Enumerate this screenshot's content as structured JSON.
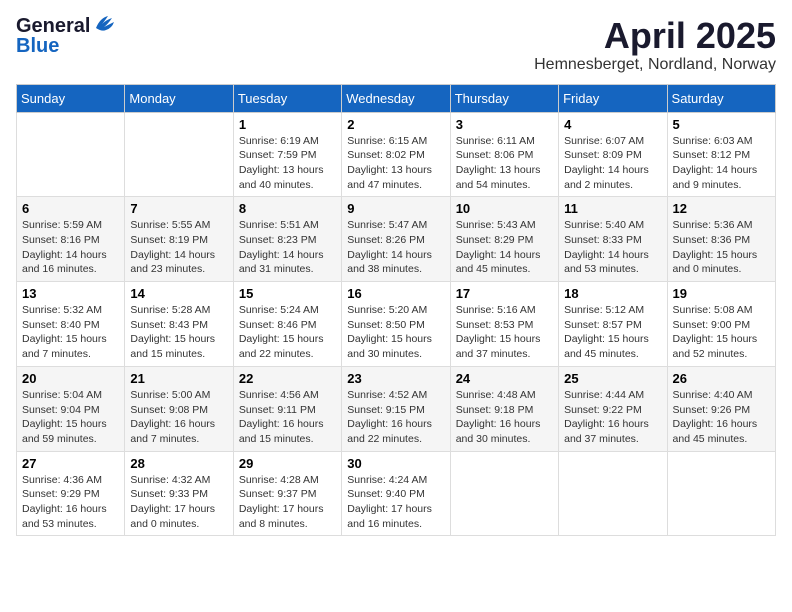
{
  "logo": {
    "general": "General",
    "blue": "Blue"
  },
  "header": {
    "month": "April 2025",
    "location": "Hemnesberget, Nordland, Norway"
  },
  "weekdays": [
    "Sunday",
    "Monday",
    "Tuesday",
    "Wednesday",
    "Thursday",
    "Friday",
    "Saturday"
  ],
  "weeks": [
    [
      {
        "day": "",
        "sunrise": "",
        "sunset": "",
        "daylight": ""
      },
      {
        "day": "",
        "sunrise": "",
        "sunset": "",
        "daylight": ""
      },
      {
        "day": "1",
        "sunrise": "Sunrise: 6:19 AM",
        "sunset": "Sunset: 7:59 PM",
        "daylight": "Daylight: 13 hours and 40 minutes."
      },
      {
        "day": "2",
        "sunrise": "Sunrise: 6:15 AM",
        "sunset": "Sunset: 8:02 PM",
        "daylight": "Daylight: 13 hours and 47 minutes."
      },
      {
        "day": "3",
        "sunrise": "Sunrise: 6:11 AM",
        "sunset": "Sunset: 8:06 PM",
        "daylight": "Daylight: 13 hours and 54 minutes."
      },
      {
        "day": "4",
        "sunrise": "Sunrise: 6:07 AM",
        "sunset": "Sunset: 8:09 PM",
        "daylight": "Daylight: 14 hours and 2 minutes."
      },
      {
        "day": "5",
        "sunrise": "Sunrise: 6:03 AM",
        "sunset": "Sunset: 8:12 PM",
        "daylight": "Daylight: 14 hours and 9 minutes."
      }
    ],
    [
      {
        "day": "6",
        "sunrise": "Sunrise: 5:59 AM",
        "sunset": "Sunset: 8:16 PM",
        "daylight": "Daylight: 14 hours and 16 minutes."
      },
      {
        "day": "7",
        "sunrise": "Sunrise: 5:55 AM",
        "sunset": "Sunset: 8:19 PM",
        "daylight": "Daylight: 14 hours and 23 minutes."
      },
      {
        "day": "8",
        "sunrise": "Sunrise: 5:51 AM",
        "sunset": "Sunset: 8:23 PM",
        "daylight": "Daylight: 14 hours and 31 minutes."
      },
      {
        "day": "9",
        "sunrise": "Sunrise: 5:47 AM",
        "sunset": "Sunset: 8:26 PM",
        "daylight": "Daylight: 14 hours and 38 minutes."
      },
      {
        "day": "10",
        "sunrise": "Sunrise: 5:43 AM",
        "sunset": "Sunset: 8:29 PM",
        "daylight": "Daylight: 14 hours and 45 minutes."
      },
      {
        "day": "11",
        "sunrise": "Sunrise: 5:40 AM",
        "sunset": "Sunset: 8:33 PM",
        "daylight": "Daylight: 14 hours and 53 minutes."
      },
      {
        "day": "12",
        "sunrise": "Sunrise: 5:36 AM",
        "sunset": "Sunset: 8:36 PM",
        "daylight": "Daylight: 15 hours and 0 minutes."
      }
    ],
    [
      {
        "day": "13",
        "sunrise": "Sunrise: 5:32 AM",
        "sunset": "Sunset: 8:40 PM",
        "daylight": "Daylight: 15 hours and 7 minutes."
      },
      {
        "day": "14",
        "sunrise": "Sunrise: 5:28 AM",
        "sunset": "Sunset: 8:43 PM",
        "daylight": "Daylight: 15 hours and 15 minutes."
      },
      {
        "day": "15",
        "sunrise": "Sunrise: 5:24 AM",
        "sunset": "Sunset: 8:46 PM",
        "daylight": "Daylight: 15 hours and 22 minutes."
      },
      {
        "day": "16",
        "sunrise": "Sunrise: 5:20 AM",
        "sunset": "Sunset: 8:50 PM",
        "daylight": "Daylight: 15 hours and 30 minutes."
      },
      {
        "day": "17",
        "sunrise": "Sunrise: 5:16 AM",
        "sunset": "Sunset: 8:53 PM",
        "daylight": "Daylight: 15 hours and 37 minutes."
      },
      {
        "day": "18",
        "sunrise": "Sunrise: 5:12 AM",
        "sunset": "Sunset: 8:57 PM",
        "daylight": "Daylight: 15 hours and 45 minutes."
      },
      {
        "day": "19",
        "sunrise": "Sunrise: 5:08 AM",
        "sunset": "Sunset: 9:00 PM",
        "daylight": "Daylight: 15 hours and 52 minutes."
      }
    ],
    [
      {
        "day": "20",
        "sunrise": "Sunrise: 5:04 AM",
        "sunset": "Sunset: 9:04 PM",
        "daylight": "Daylight: 15 hours and 59 minutes."
      },
      {
        "day": "21",
        "sunrise": "Sunrise: 5:00 AM",
        "sunset": "Sunset: 9:08 PM",
        "daylight": "Daylight: 16 hours and 7 minutes."
      },
      {
        "day": "22",
        "sunrise": "Sunrise: 4:56 AM",
        "sunset": "Sunset: 9:11 PM",
        "daylight": "Daylight: 16 hours and 15 minutes."
      },
      {
        "day": "23",
        "sunrise": "Sunrise: 4:52 AM",
        "sunset": "Sunset: 9:15 PM",
        "daylight": "Daylight: 16 hours and 22 minutes."
      },
      {
        "day": "24",
        "sunrise": "Sunrise: 4:48 AM",
        "sunset": "Sunset: 9:18 PM",
        "daylight": "Daylight: 16 hours and 30 minutes."
      },
      {
        "day": "25",
        "sunrise": "Sunrise: 4:44 AM",
        "sunset": "Sunset: 9:22 PM",
        "daylight": "Daylight: 16 hours and 37 minutes."
      },
      {
        "day": "26",
        "sunrise": "Sunrise: 4:40 AM",
        "sunset": "Sunset: 9:26 PM",
        "daylight": "Daylight: 16 hours and 45 minutes."
      }
    ],
    [
      {
        "day": "27",
        "sunrise": "Sunrise: 4:36 AM",
        "sunset": "Sunset: 9:29 PM",
        "daylight": "Daylight: 16 hours and 53 minutes."
      },
      {
        "day": "28",
        "sunrise": "Sunrise: 4:32 AM",
        "sunset": "Sunset: 9:33 PM",
        "daylight": "Daylight: 17 hours and 0 minutes."
      },
      {
        "day": "29",
        "sunrise": "Sunrise: 4:28 AM",
        "sunset": "Sunset: 9:37 PM",
        "daylight": "Daylight: 17 hours and 8 minutes."
      },
      {
        "day": "30",
        "sunrise": "Sunrise: 4:24 AM",
        "sunset": "Sunset: 9:40 PM",
        "daylight": "Daylight: 17 hours and 16 minutes."
      },
      {
        "day": "",
        "sunrise": "",
        "sunset": "",
        "daylight": ""
      },
      {
        "day": "",
        "sunrise": "",
        "sunset": "",
        "daylight": ""
      },
      {
        "day": "",
        "sunrise": "",
        "sunset": "",
        "daylight": ""
      }
    ]
  ]
}
